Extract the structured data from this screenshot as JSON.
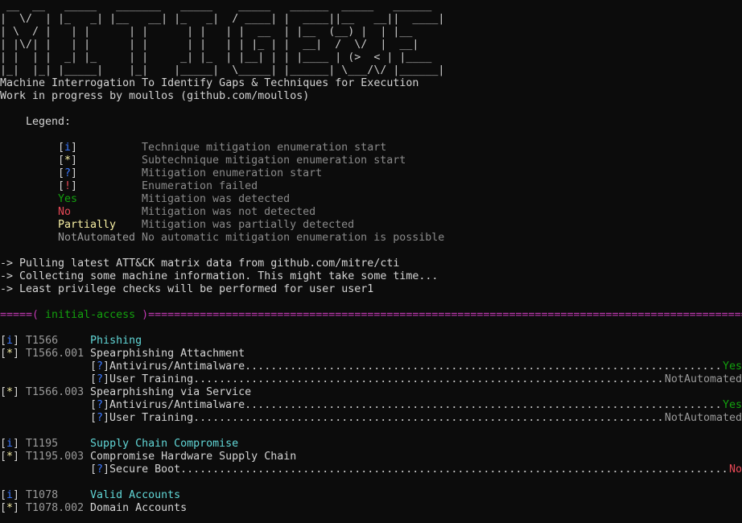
{
  "banner": [
    " __  __   _____   _______   _____    _____   ______  _____   ______",
    "|  \\/  | |_   _| |__   __| |_   _|  / ____| |  ____||__   __||  ____|",
    "| \\  / |   | |      | |      | |   | |  __  | |__  (__) |  | |__",
    "| |\\/| |   | |      | |      | |   | | |_ | |  __|  /  \\/  |  __|",
    "| |  | |  _| |_     | |     _| |_  | |__| | | |____ | (>  < | |____",
    "|_|  |_| |_____|    |_|    |_____|  \\_____| |______| \\___/\\/ |______|"
  ],
  "intro": {
    "tagline": "Machine Interrogation To Identify Gaps & Techniques for Execution",
    "credit": "Work in progress by moullos (github.com/moullos)"
  },
  "legend": {
    "title": "    Legend:",
    "items": [
      {
        "key_open": "[",
        "key_sym": "i",
        "key_close": "]",
        "desc": "Technique mitigation enumeration start",
        "color": "#3b78ff"
      },
      {
        "key_open": "[",
        "key_sym": "*",
        "key_close": "]",
        "desc": "Subtechnique mitigation enumeration start",
        "color": "#f9f1a5"
      },
      {
        "key_open": "[",
        "key_sym": "?",
        "key_close": "]",
        "desc": "Mitigation enumeration start",
        "color": "#3b78ff"
      },
      {
        "key_open": "[",
        "key_sym": "!",
        "key_close": "]",
        "desc": "Enumeration failed",
        "color": "#e74856"
      },
      {
        "label": "Yes",
        "desc": "Mitigation was detected",
        "color": "#13a10e"
      },
      {
        "label": "No",
        "desc": "Mitigation was not detected",
        "color": "#e74856"
      },
      {
        "label": "Partially",
        "desc": "Mitigation was partially detected",
        "color": "#f9f1a5"
      },
      {
        "label": "NotAutomated",
        "desc": "No automatic mitigation enumeration is possible",
        "color": "#9a9a9a"
      }
    ]
  },
  "status": [
    "-> Pulling latest ATT&CK matrix data from github.com/mitre/cti",
    "-> Collecting some machine information. This might take some time...",
    "-> Least privilege checks will be performed for user user1"
  ],
  "section": {
    "prefix": "=====( ",
    "name": "initial-access",
    "suffix": " )",
    "fill": "============================================================================================================================================"
  },
  "groups": [
    {
      "technique": {
        "tag": "i",
        "id": "T1566",
        "name": "Phishing"
      },
      "subtechniques": [
        {
          "tag": "*",
          "id": "T1566.001",
          "name": "Spearphishing Attachment",
          "mitigations": [
            {
              "name": "Antivirus/Antimalware",
              "result": "Yes",
              "color": "#13a10e"
            },
            {
              "name": "User Training",
              "result": "NotAutomated",
              "color": "#9a9a9a"
            }
          ]
        },
        {
          "tag": "*",
          "id": "T1566.003",
          "name": "Spearphishing via Service",
          "mitigations": [
            {
              "name": "Antivirus/Antimalware",
              "result": "Yes",
              "color": "#13a10e"
            },
            {
              "name": "User Training",
              "result": "NotAutomated",
              "color": "#9a9a9a"
            }
          ]
        }
      ]
    },
    {
      "technique": {
        "tag": "i",
        "id": "T1195",
        "name": "Supply Chain Compromise"
      },
      "subtechniques": [
        {
          "tag": "*",
          "id": "T1195.003",
          "name": "Compromise Hardware Supply Chain",
          "mitigations": [
            {
              "name": "Secure Boot",
              "result": "No",
              "color": "#e74856"
            }
          ]
        }
      ]
    },
    {
      "technique": {
        "tag": "i",
        "id": "T1078",
        "name": "Valid Accounts"
      },
      "subtechniques": [
        {
          "tag": "*",
          "id": "T1078.002",
          "name": "Domain Accounts",
          "mitigations": []
        }
      ]
    }
  ],
  "dots": "...................................................................................................................................................................."
}
